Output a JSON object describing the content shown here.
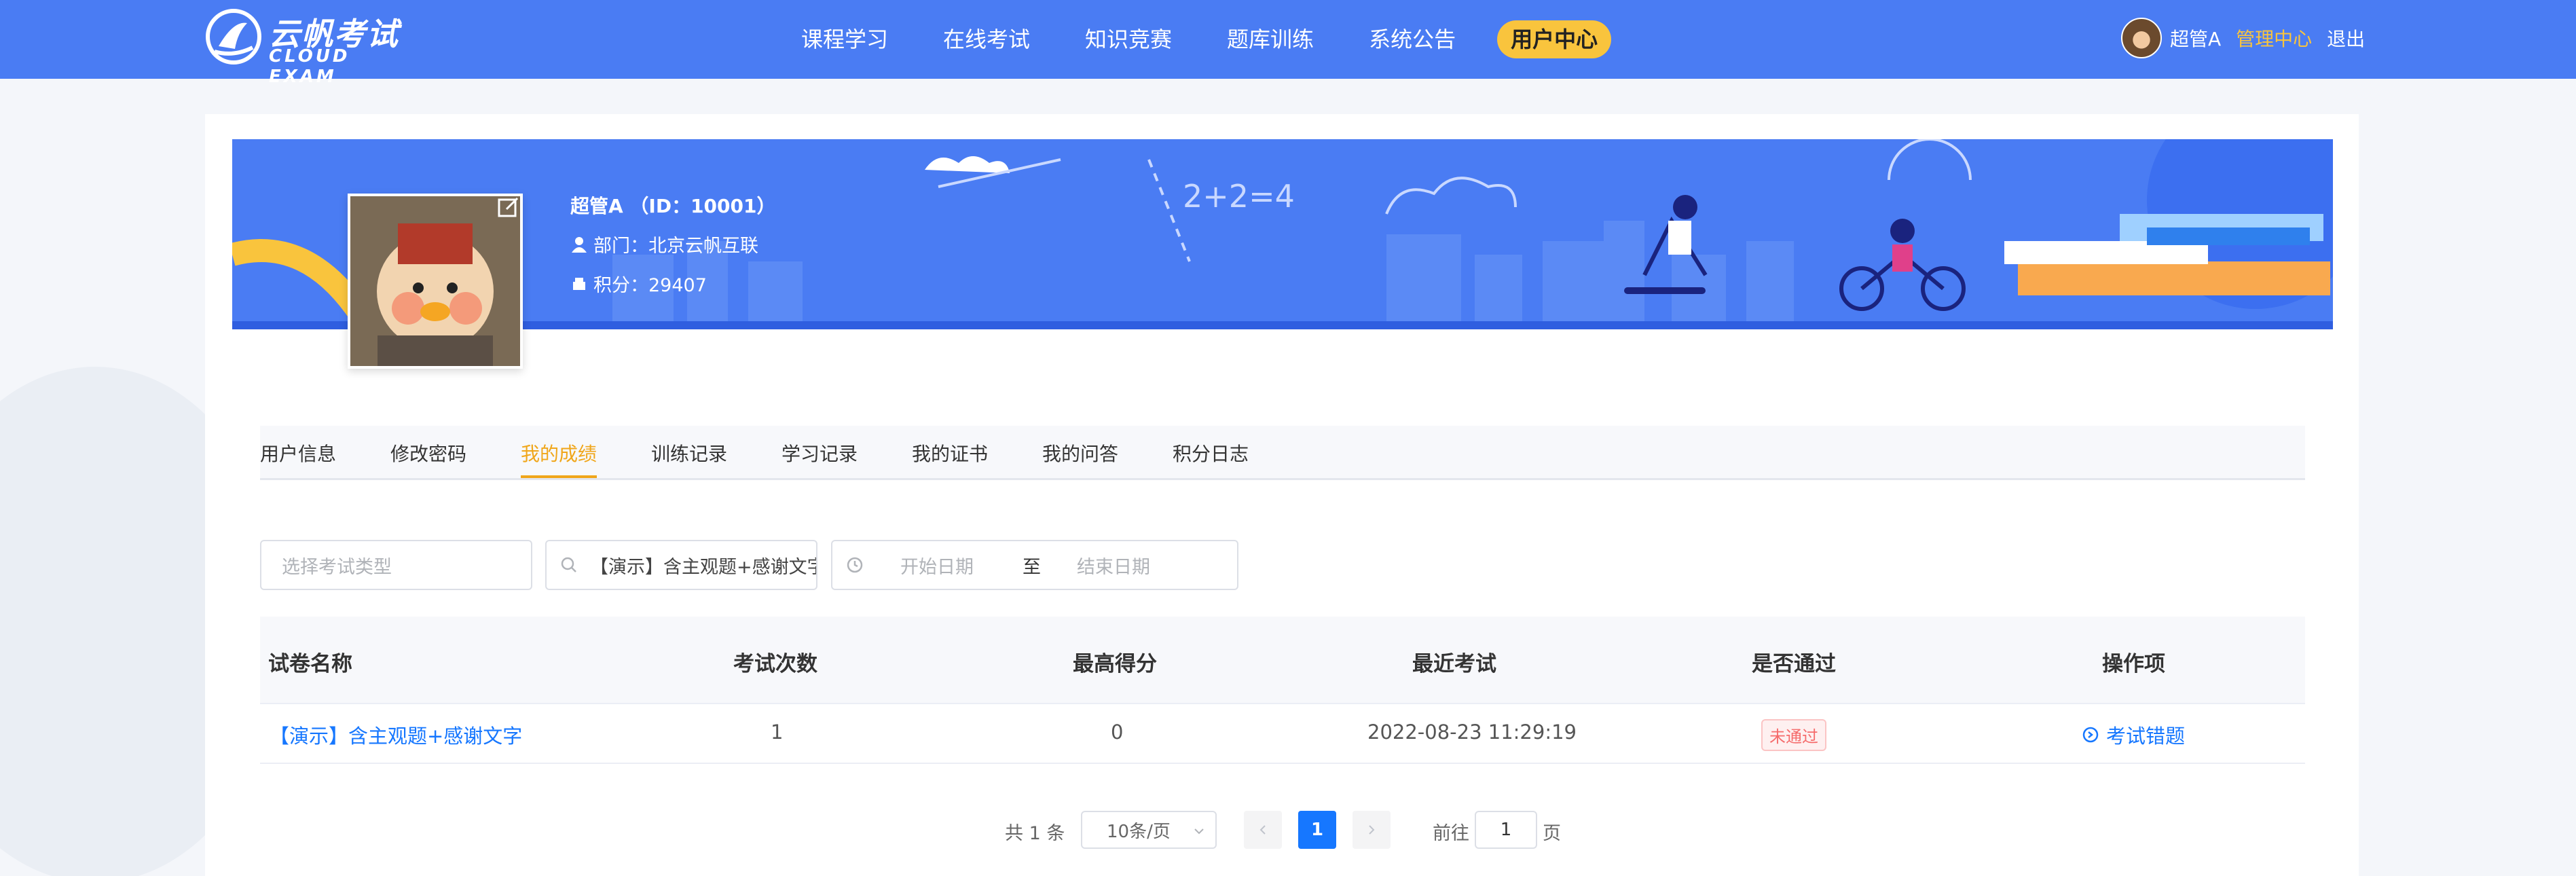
{
  "header": {
    "logo_main": "云帆考试",
    "logo_sub": "CLOUD EXAM",
    "nav": [
      {
        "label": "课程学习"
      },
      {
        "label": "在线考试"
      },
      {
        "label": "知识竞赛"
      },
      {
        "label": "题库训练"
      },
      {
        "label": "系统公告"
      },
      {
        "label": "用户中心",
        "active": true
      }
    ],
    "user_name": "超管A",
    "admin_link": "管理中心",
    "logout": "退出"
  },
  "profile": {
    "title": "超管A （ID：10001）",
    "department": "部门：北京云帆互联",
    "points": "积分：29407"
  },
  "tabs": [
    {
      "label": "用户信息"
    },
    {
      "label": "修改密码"
    },
    {
      "label": "我的成绩",
      "active": true
    },
    {
      "label": "训练记录"
    },
    {
      "label": "学习记录"
    },
    {
      "label": "我的证书"
    },
    {
      "label": "我的问答"
    },
    {
      "label": "积分日志"
    }
  ],
  "filters": {
    "exam_type_placeholder": "选择考试类型",
    "search_value": "【演示】含主观题+感谢文字",
    "start_placeholder": "开始日期",
    "range_separator": "至",
    "end_placeholder": "结束日期"
  },
  "table": {
    "columns": [
      "试卷名称",
      "考试次数",
      "最高得分",
      "最近考试",
      "是否通过",
      "操作项"
    ],
    "rows": [
      {
        "name": "【演示】含主观题+感谢文字",
        "count": "1",
        "max_score": "0",
        "last_exam": "2022-08-23 11:29:19",
        "passed": "未通过",
        "action": "考试错题"
      }
    ]
  },
  "pagination": {
    "total": "共 1 条",
    "page_size": "10条/页",
    "current_page": "1",
    "goto_label": "前往",
    "goto_value": "1",
    "page_suffix": "页"
  },
  "colors": {
    "primary": "#4a7cf3",
    "accent": "#f9c43d",
    "link": "#1677ff",
    "tab_active": "#f0a61a",
    "fail": "#f56c6c"
  }
}
